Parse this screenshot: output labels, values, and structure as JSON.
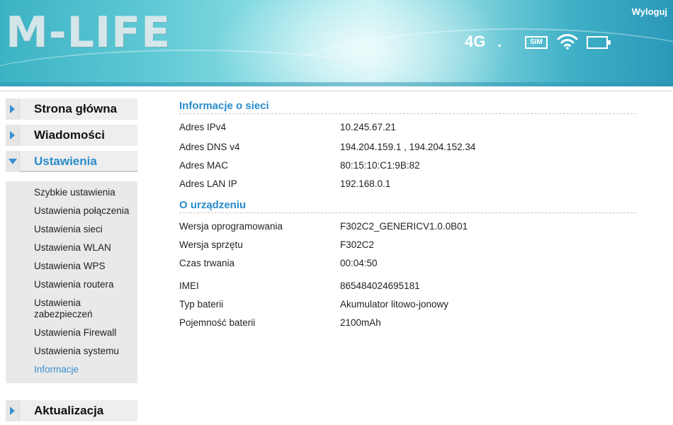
{
  "header": {
    "logo": "M-LIFE",
    "logout_label": "Wyloguj",
    "network_type": "4G",
    "signal_dot": ".",
    "sim_label": "SIM"
  },
  "sidebar": {
    "items": [
      {
        "label": "Strona główna"
      },
      {
        "label": "Wiadomości"
      },
      {
        "label": "Ustawienia"
      },
      {
        "label": "Aktualizacja"
      }
    ],
    "submenu": [
      "Szybkie ustawienia",
      "Ustawienia połączenia",
      "Ustawienia sieci",
      "Ustawienia WLAN",
      "Ustawienia WPS",
      "Ustawienia routera",
      "Ustawienia zabezpieczeń",
      "Ustawienia Firewall",
      "Ustawienia systemu",
      "Informacje"
    ]
  },
  "main": {
    "network_section": {
      "title": "Informacje o sieci",
      "rows": [
        {
          "key": "Adres IPv4",
          "value": "10.245.67.21"
        },
        {
          "key": "Adres DNS v4",
          "value": "194.204.159.1 , 194.204.152.34"
        },
        {
          "key": "Adres MAC",
          "value": "80:15:10:C1:9B:82"
        },
        {
          "key": "Adres LAN IP",
          "value": "192.168.0.1"
        }
      ]
    },
    "device_section": {
      "title": "O urządzeniu",
      "rows": [
        {
          "key": "Wersja oprogramowania",
          "value": "F302C2_GENERICV1.0.0B01"
        },
        {
          "key": "Wersja sprzętu",
          "value": "F302C2"
        },
        {
          "key": "Czas trwania",
          "value": "00:04:50"
        },
        {
          "key": "IMEI",
          "value": "865484024695181"
        },
        {
          "key": "Typ baterii",
          "value": "Akumulator litowo-jonowy"
        },
        {
          "key": "Pojemność baterii",
          "value": "2100mAh"
        }
      ]
    }
  },
  "colors": {
    "accent": "#2a8bc9",
    "header_teal": "#3cb3c4"
  }
}
